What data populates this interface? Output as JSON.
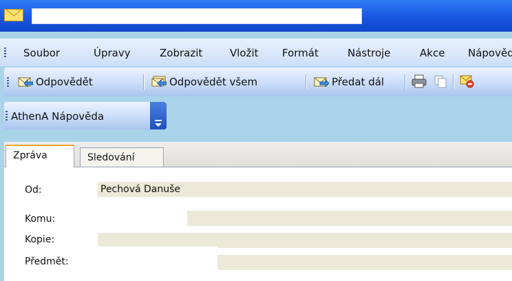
{
  "window": {
    "title": ""
  },
  "menu": [
    "Soubor",
    "Úpravy",
    "Zobrazit",
    "Vložit",
    "Formát",
    "Nástroje",
    "Akce",
    "Nápověda"
  ],
  "toolbar": {
    "reply": "Odpovědět",
    "reply_all": "Odpovědět všem",
    "forward": "Předat dál",
    "icons": [
      "reply-icon",
      "reply-all-icon",
      "forward-icon",
      "print-icon",
      "copy-icon",
      "delete-message-icon"
    ]
  },
  "athena": {
    "label": "AthenA Nápověda"
  },
  "tabs": [
    "Zpráva",
    "Sledování"
  ],
  "fields": {
    "from_label": "Od:",
    "from_value": "Pechová Danuše",
    "to_label": "Komu:",
    "to_value": "",
    "cc_label": "Kopie:",
    "cc_value": "",
    "subject_label": "Předmět:",
    "subject_value": ""
  },
  "colors": {
    "titlebar": "#1857e0",
    "menubar": "#d8e6fb",
    "field_bg": "#ece9d8",
    "active_tab_accent": "#f0a830"
  }
}
